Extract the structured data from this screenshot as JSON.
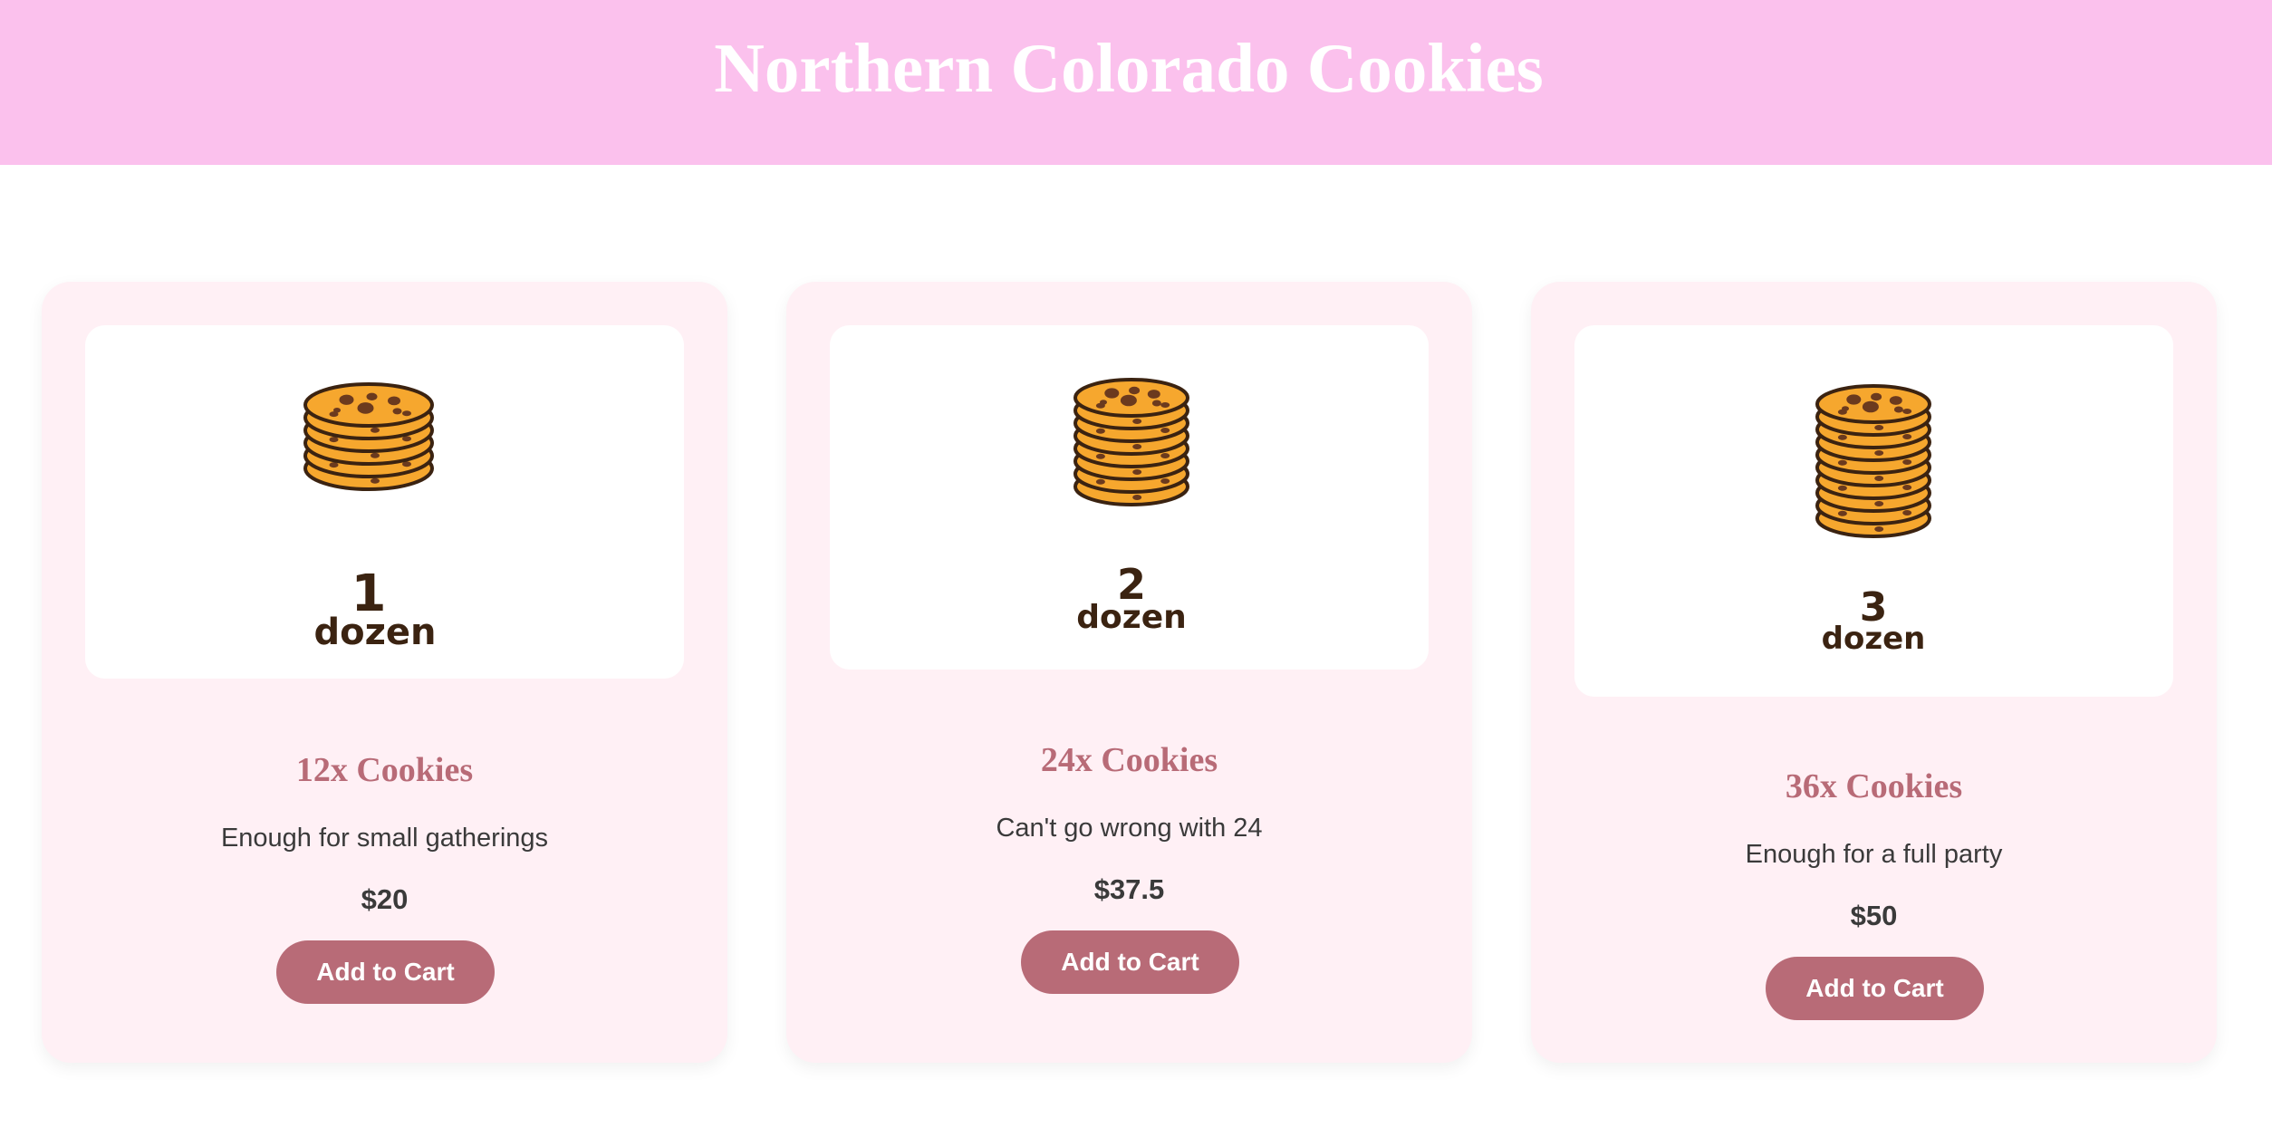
{
  "header": {
    "title": "Northern Colorado Cookies",
    "background": "#fbc1ed"
  },
  "colors": {
    "accent": "#b86b77",
    "card_bg": "#fff0f5",
    "cookie_fill": "#f6a72e",
    "cookie_outline": "#3b2311",
    "chip": "#6b3a1e"
  },
  "products": [
    {
      "title": "12x Cookies",
      "description": "Enough for small gatherings",
      "price": "$20",
      "button_label": "Add to Cart",
      "image": {
        "icon": "cookie-stack-icon",
        "number": "1",
        "unit": "dozen"
      }
    },
    {
      "title": "24x Cookies",
      "description": "Can't go wrong with 24",
      "price": "$37.5",
      "button_label": "Add to Cart",
      "image": {
        "icon": "cookie-stack-icon",
        "number": "2",
        "unit": "dozen"
      }
    },
    {
      "title": "36x Cookies",
      "description": "Enough for a full party",
      "price": "$50",
      "button_label": "Add to Cart",
      "image": {
        "icon": "cookie-stack-icon",
        "number": "3",
        "unit": "dozen"
      }
    }
  ]
}
